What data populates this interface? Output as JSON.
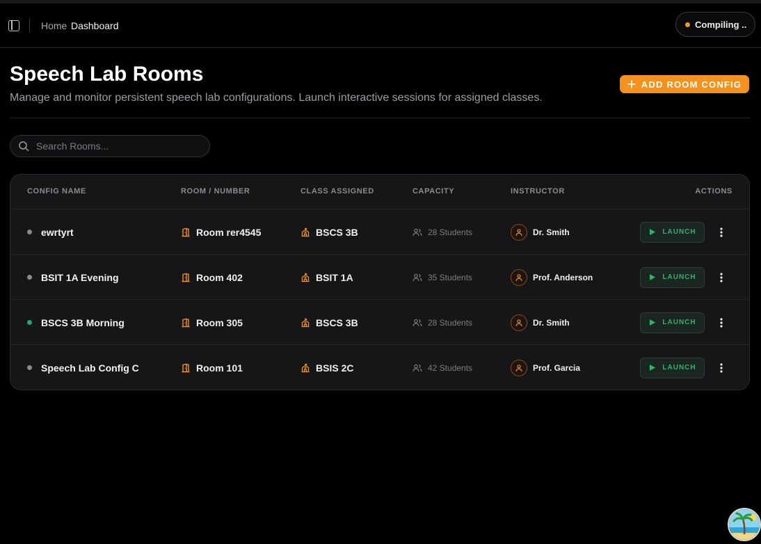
{
  "header": {
    "breadcrumb_home": "Home",
    "breadcrumb_current": "Dashboard",
    "status_label": "Compiling ..",
    "status_color": "#f39a1f"
  },
  "page": {
    "title": "Speech Lab Rooms",
    "subtitle": "Manage and monitor persistent speech lab configurations. Launch interactive sessions for assigned classes.",
    "add_button_label": "ADD ROOM CONFIG",
    "accent_color": "#f3921e"
  },
  "search": {
    "placeholder": "Search Rooms..."
  },
  "table": {
    "columns": {
      "config_name": "CONFIG NAME",
      "room": "ROOM / NUMBER",
      "class": "CLASS ASSIGNED",
      "capacity": "CAPACITY",
      "instructor": "INSTRUCTOR",
      "actions": "ACTIONS"
    },
    "launch_label": "LAUNCH",
    "rows": [
      {
        "name": "ewrtyrt",
        "status": "inactive",
        "room": "Room rer4545",
        "class": "BSCS 3B",
        "capacity": "28 Students",
        "instructor": "Dr. Smith"
      },
      {
        "name": "BSIT 1A Evening",
        "status": "inactive",
        "room": "Room 402",
        "class": "BSIT 1A",
        "capacity": "35 Students",
        "instructor": "Prof. Anderson"
      },
      {
        "name": "BSCS 3B Morning",
        "status": "active",
        "room": "Room 305",
        "class": "BSCS 3B",
        "capacity": "28 Students",
        "instructor": "Dr. Smith"
      },
      {
        "name": "Speech Lab Config C",
        "status": "inactive",
        "room": "Room 101",
        "class": "BSIS 2C",
        "capacity": "42 Students",
        "instructor": "Prof. Garcia"
      }
    ]
  },
  "colors": {
    "status_active": "#22a86a",
    "status_inactive": "#8a8a8f",
    "launch_green": "#29b66a"
  }
}
